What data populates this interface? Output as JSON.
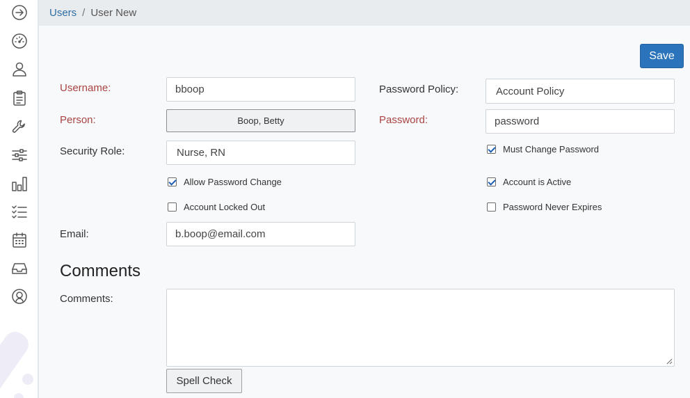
{
  "breadcrumb": {
    "parent": "Users",
    "separator": "/",
    "current": "User New"
  },
  "toolbar": {
    "save_label": "Save"
  },
  "form": {
    "username": {
      "label": "Username:",
      "value": "bboop"
    },
    "person": {
      "label": "Person:",
      "value": "Boop, Betty"
    },
    "security_role": {
      "label": "Security Role:",
      "value": "Nurse, RN"
    },
    "allow_password_change": {
      "label": "Allow Password Change",
      "checked": true
    },
    "account_locked_out": {
      "label": "Account Locked Out",
      "checked": false
    },
    "email": {
      "label": "Email:",
      "value": "b.boop@email.com"
    },
    "password_policy": {
      "label": "Password Policy:",
      "value": "Account Policy"
    },
    "password": {
      "label": "Password:",
      "value": "password"
    },
    "must_change_password": {
      "label": "Must Change Password",
      "checked": true
    },
    "account_is_active": {
      "label": "Account is Active",
      "checked": true
    },
    "password_never_expires": {
      "label": "Password Never Expires",
      "checked": false
    }
  },
  "comments": {
    "section_title": "Comments",
    "label": "Comments:",
    "value": "",
    "spell_check_label": "Spell Check"
  },
  "sidebar": {
    "items": [
      {
        "icon": "arrow-right-circle-icon"
      },
      {
        "icon": "dashboard-gauge-icon"
      },
      {
        "icon": "user-icon"
      },
      {
        "icon": "clipboard-icon"
      },
      {
        "icon": "wrench-icon"
      },
      {
        "icon": "sliders-icon"
      },
      {
        "icon": "bar-chart-icon"
      },
      {
        "icon": "checklist-icon"
      },
      {
        "icon": "calendar-icon"
      },
      {
        "icon": "inbox-icon"
      },
      {
        "icon": "user-circle-icon"
      }
    ]
  },
  "colors": {
    "accent": "#2b74bb",
    "required_label": "#a94442",
    "breadcrumb_link": "#2e6da4"
  }
}
